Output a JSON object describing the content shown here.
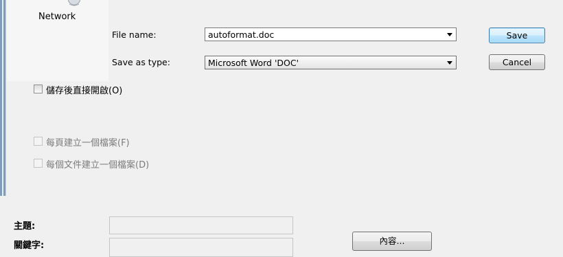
{
  "nav": {
    "network_label": "Network"
  },
  "form": {
    "file_name_label": "File name:",
    "file_name_value": "autoformat.doc",
    "save_as_type_label": "Save as type:",
    "save_as_type_value": "Microsoft Word 'DOC'"
  },
  "buttons": {
    "save": "Save",
    "cancel": "Cancel",
    "properties": "內容..."
  },
  "options": {
    "open_after_save": {
      "label": "儲存後直接開啟(O)",
      "checked": false,
      "enabled": true
    },
    "file_per_page": {
      "label": "每頁建立一個檔案(F)",
      "checked": false,
      "enabled": false
    },
    "file_per_document": {
      "label": "每個文件建立一個檔案(D)",
      "checked": false,
      "enabled": false
    }
  },
  "metadata": {
    "subject_label": "主題:",
    "subject_value": "",
    "keywords_label": "關鍵字:",
    "keywords_value": ""
  },
  "icons": [
    "network-icon",
    "dropdown-arrow-icon"
  ],
  "colors": {
    "default_button_border": "#3c7fb1",
    "window_background": "#f0f0f0",
    "disabled_text": "#7c7c7c"
  }
}
